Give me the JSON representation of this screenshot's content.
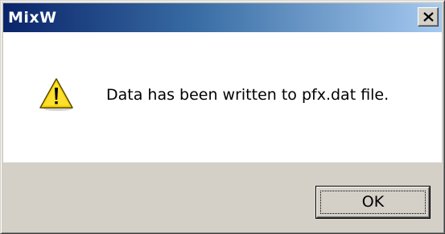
{
  "window": {
    "title": "MixW"
  },
  "titlebar": {
    "close_icon": "close-icon"
  },
  "dialog": {
    "icon": "warning-icon",
    "message": "Data has been written to pfx.dat file."
  },
  "buttons": {
    "ok_label": "OK"
  },
  "colors": {
    "titlebar_start": "#0a246a",
    "titlebar_end": "#a6caf0",
    "face": "#d4d0c8",
    "warning_yellow": "#f5d300"
  }
}
